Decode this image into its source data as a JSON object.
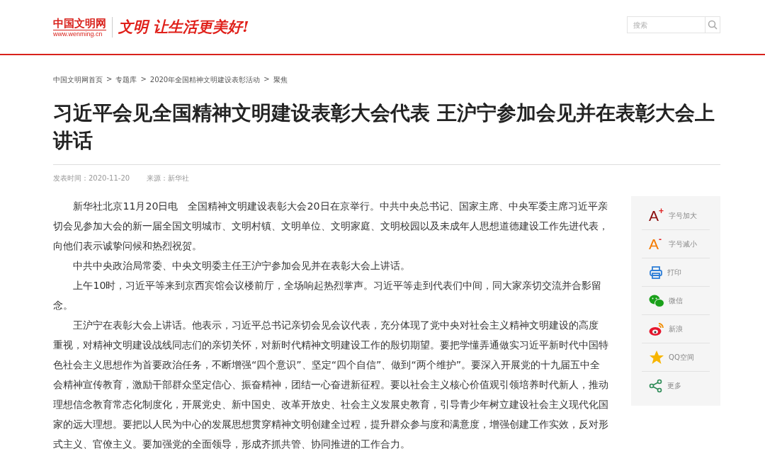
{
  "header": {
    "logo": {
      "name": "中国文明网",
      "url": "www.wenming.cn"
    },
    "slogan": "文明 让生活更美好!",
    "search": {
      "placeholder": "搜索"
    }
  },
  "breadcrumb": [
    "中国文明网首页",
    "专题库",
    "2020年全国精神文明建设表彰活动",
    "聚焦"
  ],
  "breadcrumb_separator": ">",
  "article": {
    "title": "习近平会见全国精神文明建设表彰大会代表 王沪宁参加会见并在表彰大会上讲话",
    "published": "发表时间：2020-11-20",
    "source": "来源：新华社",
    "paragraphs": [
      "新华社北京11月20日电　全国精神文明建设表彰大会20日在京举行。中共中央总书记、国家主席、中央军委主席习近平亲切会见参加大会的新一届全国文明城市、文明村镇、文明单位、文明家庭、文明校园以及未成年人思想道德建设工作先进代表，向他们表示诚挚问候和热烈祝贺。",
      "中共中央政治局常委、中央文明委主任王沪宁参加会见并在表彰大会上讲话。",
      "上午10时，习近平等来到京西宾馆会议楼前厅，全场响起热烈掌声。习近平等走到代表们中间，同大家亲切交流并合影留念。",
      "王沪宁在表彰大会上讲话。他表示，习近平总书记亲切会见会议代表，充分体现了党中央对社会主义精神文明建设的高度重视，对精神文明建设战线同志们的亲切关怀，对新时代精神文明建设工作的殷切期望。要把学懂弄通做实习近平新时代中国特色社会主义思想作为首要政治任务，不断增强“四个意识”、坚定“四个自信”、做到“两个维护”。要深入开展党的十九届五中全会精神宣传教育，激励干部群众坚定信心、振奋精神，团结一心奋进新征程。要以社会主义核心价值观引领培养时代新人，推动理想信念教育常态化制度化，开展党史、新中国史、改革开放史、社会主义发展史教育，引导青少年树立建设社会主义现代化国家的远大理想。要把以人民为中心的发展思想贯穿精神文明创建全过程，提升群众参与度和满意度，增强创建工作实效，反对形式主义、官僚主义。要加强党的全面领导，形成齐抓共管、协同推进的工作合力。"
    ]
  },
  "tools": [
    {
      "kind": "font-up",
      "glyph": "A",
      "sign": "+",
      "label": "字号加大"
    },
    {
      "kind": "font-down",
      "glyph": "A",
      "sign": "-",
      "label": "字号减小"
    },
    {
      "kind": "print",
      "label": "打印"
    },
    {
      "kind": "wechat",
      "label": "微信"
    },
    {
      "kind": "weibo",
      "label": "新浪"
    },
    {
      "kind": "qzone",
      "label": "QQ空间"
    },
    {
      "kind": "share",
      "label": "更多"
    }
  ]
}
